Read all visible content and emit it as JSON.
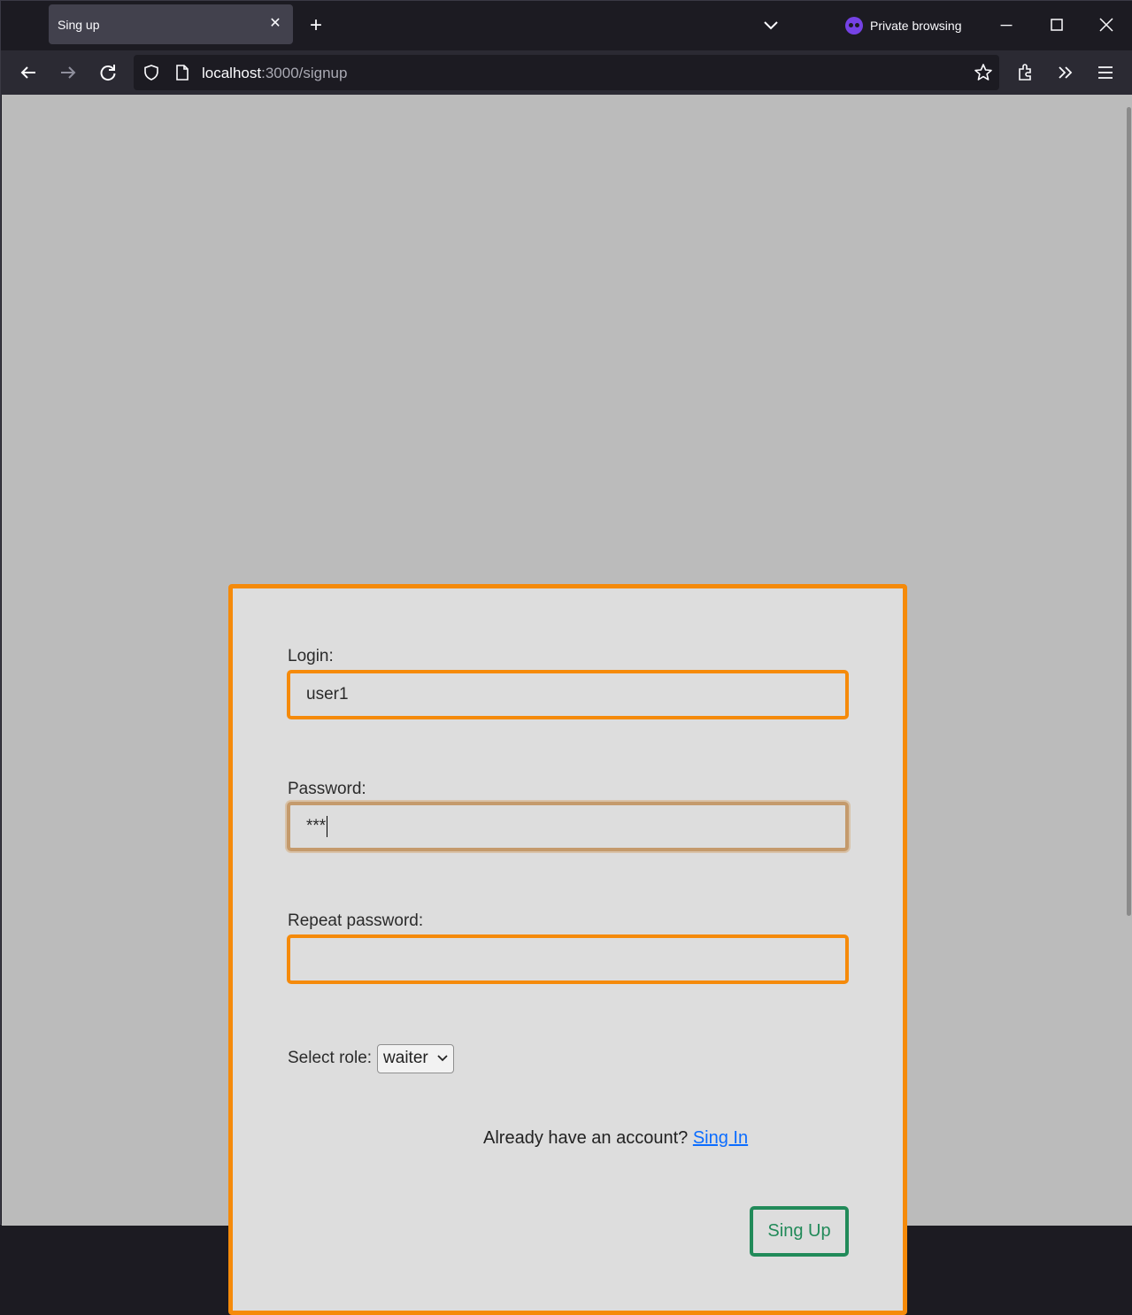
{
  "browser": {
    "tab_title": "Sing up",
    "private_label": "Private browsing",
    "url_host": "localhost",
    "url_path": ":3000/signup"
  },
  "icons": {
    "tab_close": "close-icon",
    "new_tab": "plus-icon",
    "tab_list": "chevron-down-icon",
    "private": "private-mask-icon",
    "minimize": "minimize-icon",
    "maximize": "maximize-icon",
    "close": "close-icon",
    "back": "back-arrow-icon",
    "forward": "forward-arrow-icon",
    "reload": "reload-icon",
    "shield": "shield-icon",
    "page": "page-icon",
    "bookmark": "star-icon",
    "extensions": "extensions-icon",
    "overflow": "double-chevron-icon",
    "menu": "hamburger-icon"
  },
  "form": {
    "login_label": "Login:",
    "login_value": "user1",
    "password_label": "Password:",
    "password_value": "***",
    "repeat_label": "Repeat password:",
    "repeat_value": "",
    "role_label": "Select role:",
    "role_value": "waiter",
    "already_text": "Already have an account?",
    "signin_link": "Sing In",
    "submit_label": "Sing Up"
  },
  "colors": {
    "field_border": "#f58a0a",
    "focused_border": "#c49a6c",
    "submit_accent": "#218a59",
    "link": "#0a6cff",
    "page_bg": "#bbbbbb",
    "card_bg": "#dddddd"
  }
}
